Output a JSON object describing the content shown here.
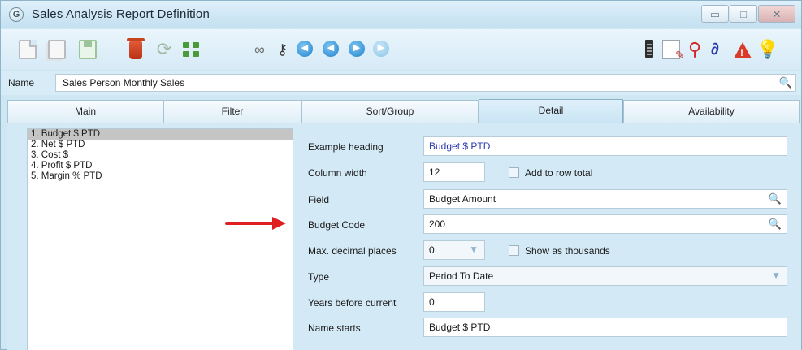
{
  "window": {
    "app_icon": "G",
    "title": "Sales Analysis Report Definition",
    "controls": [
      "minimize-icon",
      "maximize-icon",
      "close-icon"
    ]
  },
  "toolbar": {
    "icons": [
      "new-document-icon",
      "copy-document-icon",
      "save-icon",
      "delete-icon",
      "refresh-icon",
      "tree-icon",
      "binoculars-icon",
      "key-icon",
      "first-record-icon",
      "previous-record-icon",
      "next-record-icon",
      "last-record-icon",
      "film-icon",
      "note-icon",
      "attachment-icon",
      "link-icon",
      "warning-icon",
      "lightbulb-icon"
    ]
  },
  "name": {
    "label": "Name",
    "value": "Sales Person Monthly Sales"
  },
  "tabs": [
    {
      "label": "Main",
      "active": false
    },
    {
      "label": "Filter",
      "active": false
    },
    {
      "label": "Sort/Group",
      "active": false
    },
    {
      "label": "Detail",
      "active": true
    },
    {
      "label": "Availability",
      "active": false
    }
  ],
  "columns": [
    {
      "label": "1. Budget $ PTD",
      "selected": true
    },
    {
      "label": "2. Net $ PTD",
      "selected": false
    },
    {
      "label": "3. Cost $",
      "selected": false
    },
    {
      "label": "4. Profit $ PTD",
      "selected": false
    },
    {
      "label": "5. Margin % PTD",
      "selected": false
    }
  ],
  "detail": {
    "example_heading": {
      "label": "Example heading",
      "value": "Budget $ PTD"
    },
    "column_width": {
      "label": "Column width",
      "value": "12"
    },
    "add_to_row_total": {
      "label": "Add to row total",
      "checked": false
    },
    "field": {
      "label": "Field",
      "value": "Budget Amount"
    },
    "budget_code": {
      "label": "Budget Code",
      "value": "200"
    },
    "max_decimal_places": {
      "label": "Max. decimal places",
      "value": "0"
    },
    "show_as_thousands": {
      "label": "Show as thousands",
      "checked": false
    },
    "type": {
      "label": "Type",
      "value": "Period To Date"
    },
    "years_before_current": {
      "label": "Years before current",
      "value": "0"
    },
    "name_starts": {
      "label": "Name starts",
      "value": "Budget $ PTD"
    }
  },
  "colors": {
    "accent_arrow": "#e02020",
    "heading_text": "#2a3ab0",
    "selection": "#c5c5c5"
  }
}
